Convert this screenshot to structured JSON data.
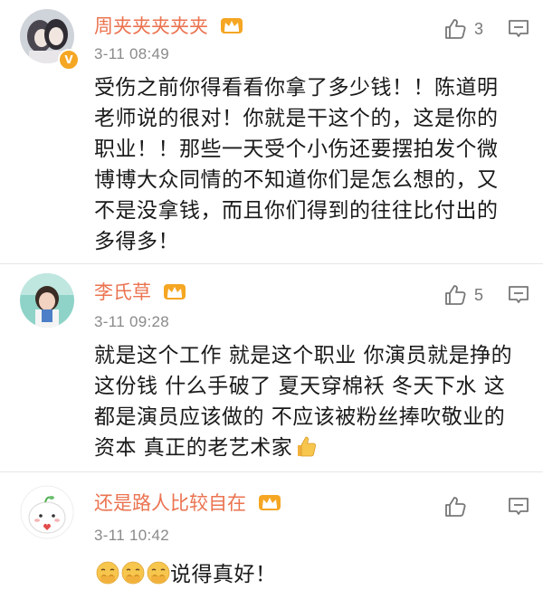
{
  "comments": [
    {
      "username": "周夹夹夹夹夹",
      "time": "3-11 08:49",
      "likes": "3",
      "body": "受伤之前你得看看你拿了多少钱！！陈道明老师说的很对！你就是干这个的，这是你的职业！！那些一天受个小伤还要摆拍发个微博博大众同情的不知道你们是怎么想的，又不是没拿钱，而且你们得到的往往比付出的多得多！"
    },
    {
      "username": "李氏草",
      "time": "3-11 09:28",
      "likes": "5",
      "body": "就是这个工作 就是这个职业 你演员就是挣的这份钱 什么手破了 夏天穿棉袄 冬天下水 这都是演员应该做的 不应该被粉丝捧吹敬业的资本 真正的老艺术家"
    },
    {
      "username": "还是路人比较自在",
      "time": "3-11 10:42",
      "likes": "",
      "body": "说得真好！"
    }
  ],
  "colors": {
    "username": "#eb7350",
    "time": "#8a8a8a",
    "text": "#1a1a1a",
    "icon": "#777777",
    "crown": "#f5a623"
  },
  "icons": [
    "crown-badge-icon",
    "thumbs-up-icon",
    "comment-reply-icon",
    "verified-icon",
    "thumbs-up-emoji",
    "smirk-emoji"
  ]
}
